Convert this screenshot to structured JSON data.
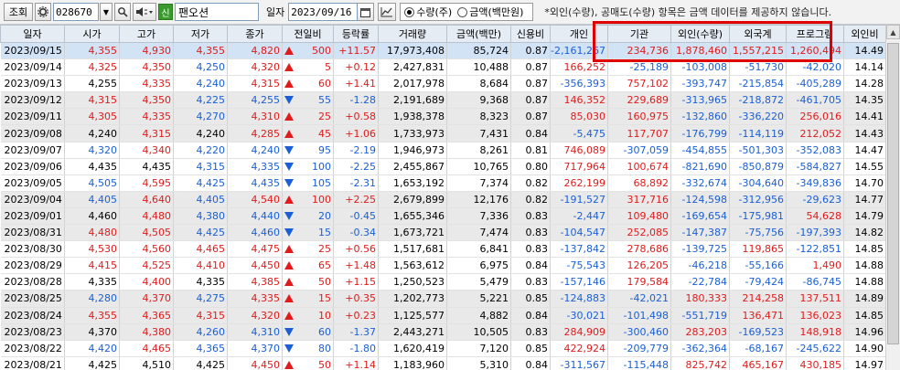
{
  "toolbar": {
    "inquiry_label": "조회",
    "code": "028670",
    "sin_label": "신",
    "stock_name": "팬오션",
    "date_label": "일자",
    "date_value": "2023/09/16",
    "radio_qty": "수량(주)",
    "radio_amt": "금액(백만원)",
    "notice": "*외인(수량), 공매도(수량) 항목은 금액 데이터를 제공하지 않습니다."
  },
  "columns": [
    "일자",
    "시가",
    "고가",
    "저가",
    "종가",
    "전일비",
    "등락률",
    "거래량",
    "금액(백만)",
    "신용비",
    "개인",
    "기관",
    "외인(수량)",
    "외국계",
    "프로그램",
    "외인비"
  ],
  "rows": [
    [
      "2023/09/15",
      "4,355",
      "4,930",
      "4,355",
      "4,820",
      "up",
      "500",
      "+11.57",
      "17,973,408",
      "85,724",
      "0.87",
      "-2,161,267",
      "234,736",
      "1,878,460",
      "1,557,215",
      "1,260,494",
      "14.49"
    ],
    [
      "2023/09/14",
      "4,325",
      "4,350",
      "4,250",
      "4,320",
      "up",
      "5",
      "+0.12",
      "2,427,831",
      "10,488",
      "0.87",
      "166,252",
      "-25,189",
      "-103,008",
      "-51,730",
      "-42,020",
      "14.14"
    ],
    [
      "2023/09/13",
      "4,255",
      "4,335",
      "4,240",
      "4,315",
      "up",
      "60",
      "+1.41",
      "2,017,978",
      "8,684",
      "0.87",
      "-356,393",
      "757,102",
      "-393,747",
      "-215,854",
      "-405,289",
      "14.28"
    ],
    [
      "2023/09/12",
      "4,315",
      "4,350",
      "4,225",
      "4,255",
      "dn",
      "55",
      "-1.28",
      "2,191,689",
      "9,368",
      "0.87",
      "146,352",
      "229,689",
      "-313,965",
      "-218,872",
      "-461,705",
      "14.35"
    ],
    [
      "2023/09/11",
      "4,305",
      "4,335",
      "4,270",
      "4,310",
      "up",
      "25",
      "+0.58",
      "1,938,378",
      "8,323",
      "0.87",
      "85,030",
      "160,975",
      "-132,860",
      "-336,220",
      "256,016",
      "14.41"
    ],
    [
      "2023/09/08",
      "4,240",
      "4,315",
      "4,240",
      "4,285",
      "up",
      "45",
      "+1.06",
      "1,733,973",
      "7,431",
      "0.84",
      "-5,475",
      "117,707",
      "-176,799",
      "-114,119",
      "212,052",
      "14.43"
    ],
    [
      "2023/09/07",
      "4,320",
      "4,340",
      "4,220",
      "4,240",
      "dn",
      "95",
      "-2.19",
      "1,946,973",
      "8,261",
      "0.81",
      "746,089",
      "-307,059",
      "-454,855",
      "-501,303",
      "-352,083",
      "14.47"
    ],
    [
      "2023/09/06",
      "4,435",
      "4,435",
      "4,315",
      "4,335",
      "dn",
      "100",
      "-2.25",
      "2,455,867",
      "10,765",
      "0.80",
      "717,964",
      "100,674",
      "-821,690",
      "-850,879",
      "-584,827",
      "14.55"
    ],
    [
      "2023/09/05",
      "4,505",
      "4,595",
      "4,425",
      "4,435",
      "dn",
      "105",
      "-2.31",
      "1,653,192",
      "7,374",
      "0.82",
      "262,199",
      "68,892",
      "-332,674",
      "-304,640",
      "-349,836",
      "14.70"
    ],
    [
      "2023/09/04",
      "4,405",
      "4,640",
      "4,405",
      "4,540",
      "up",
      "100",
      "+2.25",
      "2,679,899",
      "12,176",
      "0.82",
      "-191,527",
      "317,716",
      "-124,598",
      "-312,956",
      "-29,623",
      "14.77"
    ],
    [
      "2023/09/01",
      "4,460",
      "4,480",
      "4,380",
      "4,440",
      "dn",
      "20",
      "-0.45",
      "1,655,346",
      "7,336",
      "0.83",
      "-2,447",
      "109,480",
      "-169,654",
      "-175,981",
      "54,628",
      "14.79"
    ],
    [
      "2023/08/31",
      "4,480",
      "4,505",
      "4,425",
      "4,460",
      "dn",
      "15",
      "-0.34",
      "1,673,721",
      "7,474",
      "0.83",
      "-104,547",
      "252,085",
      "-147,387",
      "-75,756",
      "-197,393",
      "14.82"
    ],
    [
      "2023/08/30",
      "4,530",
      "4,560",
      "4,465",
      "4,475",
      "up",
      "25",
      "+0.56",
      "1,517,681",
      "6,841",
      "0.83",
      "-137,842",
      "278,686",
      "-139,725",
      "119,865",
      "-122,851",
      "14.85"
    ],
    [
      "2023/08/29",
      "4,415",
      "4,525",
      "4,410",
      "4,450",
      "up",
      "65",
      "+1.48",
      "1,563,612",
      "6,975",
      "0.84",
      "-75,543",
      "126,205",
      "-46,218",
      "-55,166",
      "1,490",
      "14.88"
    ],
    [
      "2023/08/28",
      "4,335",
      "4,400",
      "4,335",
      "4,385",
      "up",
      "50",
      "+1.15",
      "1,250,523",
      "5,479",
      "0.83",
      "-157,146",
      "179,584",
      "-22,784",
      "-79,424",
      "-86,745",
      "14.88"
    ],
    [
      "2023/08/25",
      "4,280",
      "4,370",
      "4,275",
      "4,335",
      "up",
      "15",
      "+0.35",
      "1,202,773",
      "5,221",
      "0.85",
      "-124,883",
      "-42,021",
      "180,333",
      "214,258",
      "137,511",
      "14.89"
    ],
    [
      "2023/08/24",
      "4,355",
      "4,365",
      "4,315",
      "4,320",
      "up",
      "10",
      "+0.23",
      "1,125,577",
      "4,882",
      "0.84",
      "-30,021",
      "-101,498",
      "-551,719",
      "136,471",
      "136,023",
      "14.85"
    ],
    [
      "2023/08/23",
      "4,370",
      "4,380",
      "4,260",
      "4,310",
      "dn",
      "60",
      "-1.37",
      "2,443,271",
      "10,505",
      "0.83",
      "284,909",
      "-300,460",
      "283,203",
      "-169,523",
      "148,918",
      "14.96"
    ],
    [
      "2023/08/22",
      "4,420",
      "4,465",
      "4,365",
      "4,370",
      "dn",
      "80",
      "-1.80",
      "1,620,419",
      "7,120",
      "0.85",
      "422,924",
      "-209,779",
      "-362,364",
      "-68,167",
      "-245,622",
      "14.90"
    ],
    [
      "2023/08/21",
      "4,425",
      "4,510",
      "4,425",
      "4,450",
      "up",
      "50",
      "+1.14",
      "1,183,960",
      "5,310",
      "0.84",
      "-311,567",
      "-115,448",
      "825,742",
      "465,167",
      "430,185",
      "14.97"
    ]
  ],
  "colors": {
    "up": "#e11b1b",
    "down": "#1a5fd6",
    "selected_row": "#d2e3f6",
    "alt_row": "#e9e9e9",
    "highlight": "#e00000"
  },
  "highlighted_columns": [
    "기관",
    "외인(수량)",
    "외국계",
    "프로그램"
  ]
}
